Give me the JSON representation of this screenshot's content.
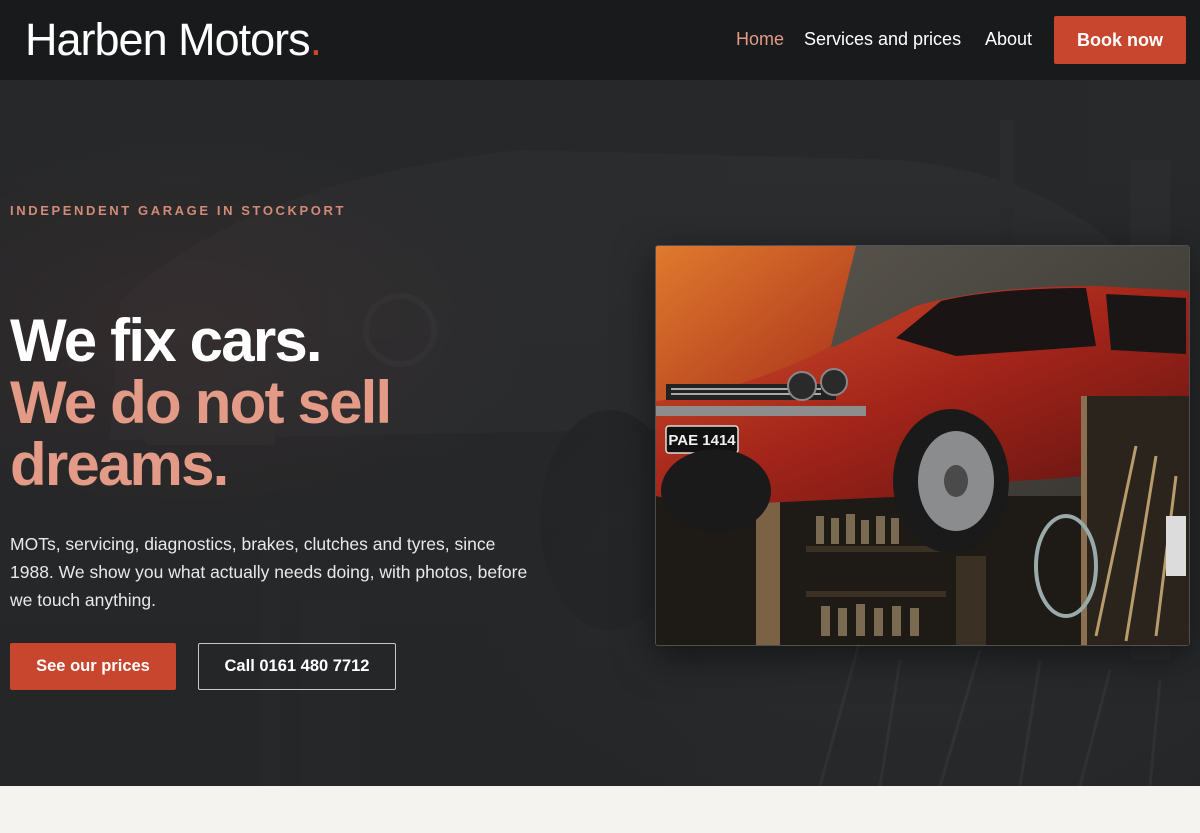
{
  "brand": {
    "name": "Harben Motors",
    "dot": ".",
    "accent": "#c8452e",
    "accent_light": "#e39a86"
  },
  "nav": {
    "items": [
      {
        "label": "Home",
        "active": true
      },
      {
        "label": "Services and prices",
        "active": false
      },
      {
        "label": "About",
        "active": false
      }
    ],
    "cta": "Book now"
  },
  "hero": {
    "eyebrow": "INDEPENDENT GARAGE IN STOCKPORT",
    "headline_1": "We fix cars.",
    "headline_2": "We do not sell dreams.",
    "lede": "MOTs, servicing, diagnostics, brakes, clutches and tyres, since 1988. We show you what actually needs doing, with photos, before we touch anything.",
    "primary_cta": "See our prices",
    "secondary_cta": "Call 0161 480 7712",
    "photo": {
      "plate": "PAE 1414"
    }
  }
}
